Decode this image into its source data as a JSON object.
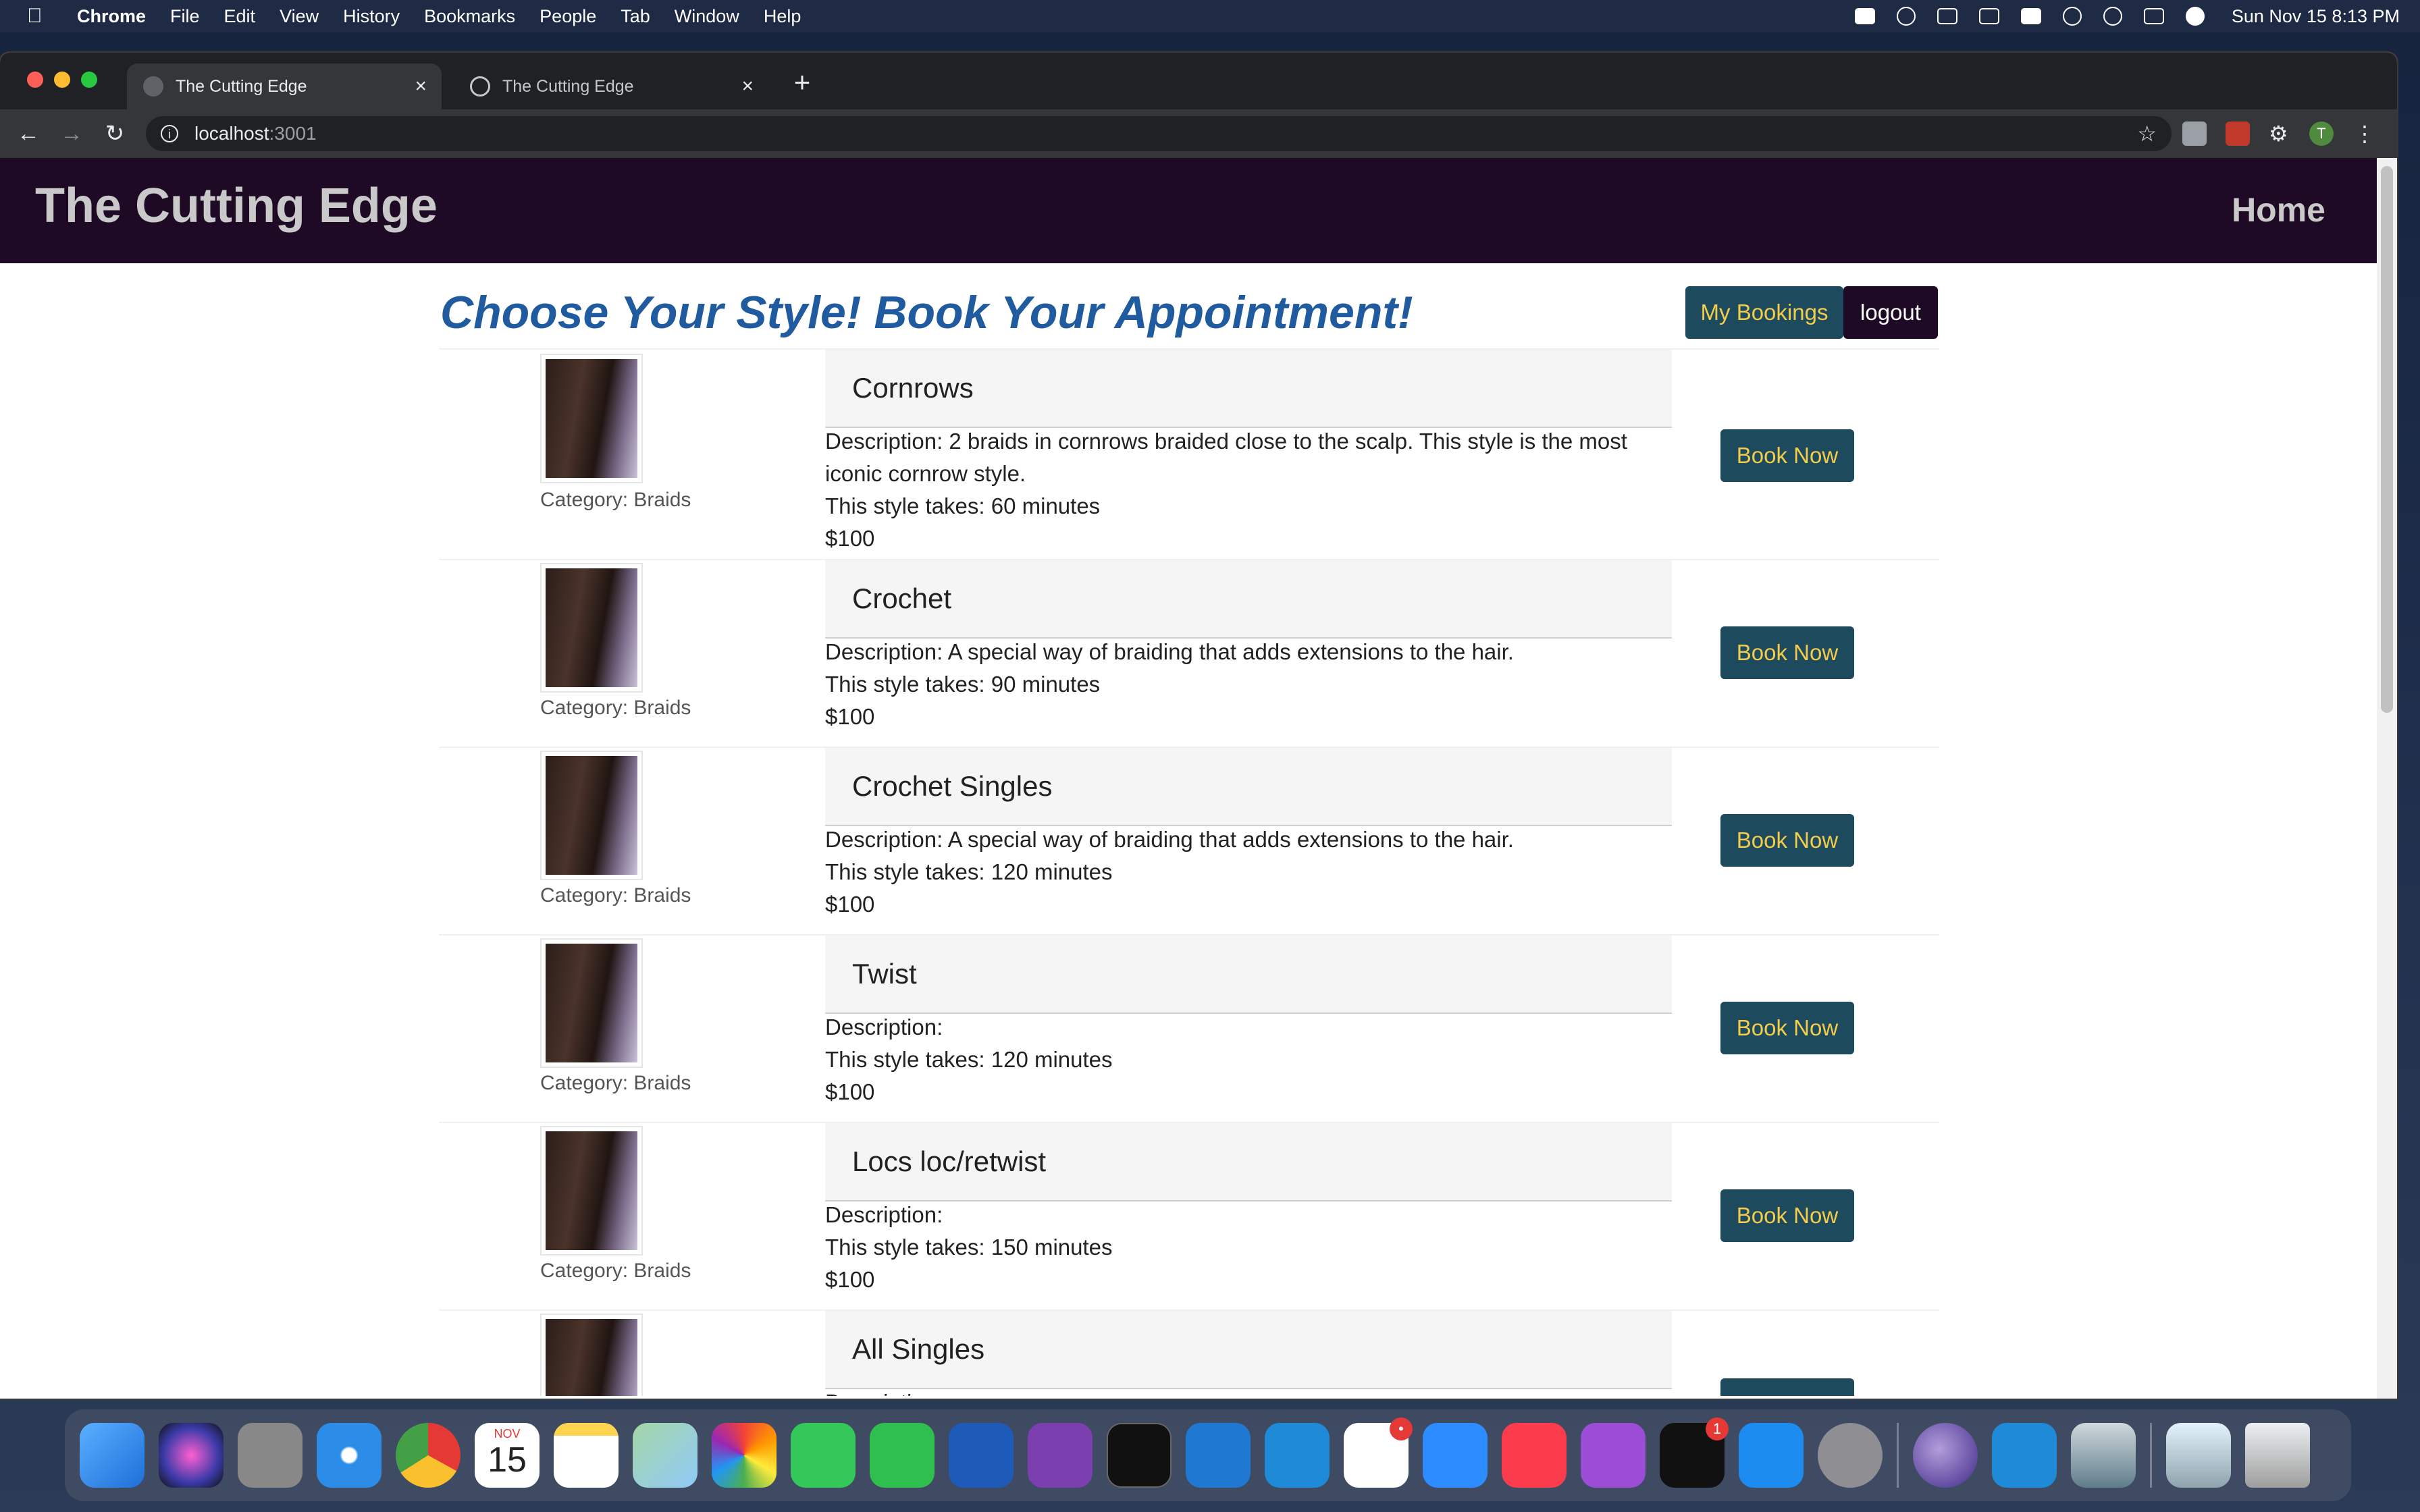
{
  "menubar": {
    "app": "Chrome",
    "items": [
      "File",
      "Edit",
      "View",
      "History",
      "Bookmarks",
      "People",
      "Tab",
      "Window",
      "Help"
    ],
    "clock": "Sun Nov 15  8:13 PM"
  },
  "browser": {
    "tabs": [
      {
        "title": "The Cutting Edge",
        "active": true
      },
      {
        "title": "The Cutting Edge",
        "active": false
      }
    ],
    "url_host": "localhost",
    "url_port": ":3001",
    "profile_initial": "T"
  },
  "site": {
    "brand": "The Cutting Edge",
    "nav_home": "Home",
    "heading": "Choose Your Style! Book Your Appointment!",
    "my_bookings": "My Bookings",
    "logout": "logout",
    "book_label": "Book Now",
    "styles": [
      {
        "name": "Cornrows",
        "category": "Category: Braids",
        "description": "Description: 2 braids in cornrows braided close to the scalp. This style is the most iconic cornrow style.",
        "duration": "This style takes: 60 minutes",
        "price": "$100"
      },
      {
        "name": "Crochet",
        "category": "Category: Braids",
        "description": "Description: A special way of braiding that adds extensions to the hair.",
        "duration": "This style takes: 90 minutes",
        "price": "$100"
      },
      {
        "name": "Crochet Singles",
        "category": "Category: Braids",
        "description": "Description: A special way of braiding that adds extensions to the hair.",
        "duration": "This style takes: 120 minutes",
        "price": "$100"
      },
      {
        "name": "Twist",
        "category": "Category: Braids",
        "description": "Description:",
        "duration": "This style takes: 120 minutes",
        "price": "$100"
      },
      {
        "name": "Locs loc/retwist",
        "category": "Category: Braids",
        "description": "Description:",
        "duration": "This style takes: 150 minutes",
        "price": "$100"
      },
      {
        "name": "All Singles",
        "category": "",
        "description": "Description:",
        "duration": "",
        "price": ""
      }
    ]
  },
  "dock": {
    "calendar_month": "NOV",
    "calendar_day": "15",
    "slack_badge": "•",
    "tv_badge": "1"
  }
}
